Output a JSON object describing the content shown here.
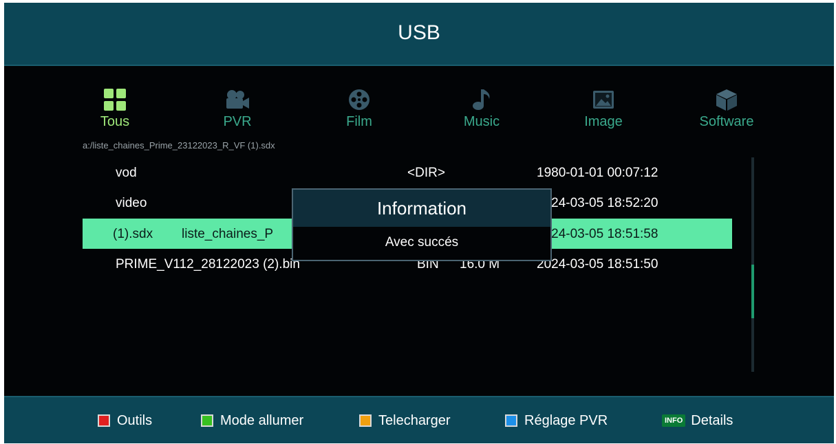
{
  "header": {
    "title": "USB"
  },
  "categories": [
    {
      "label": "Tous",
      "icon": "grid-icon",
      "active": true
    },
    {
      "label": "PVR",
      "icon": "camera-icon",
      "active": false
    },
    {
      "label": "Film",
      "icon": "film-reel-icon",
      "active": false
    },
    {
      "label": "Music",
      "icon": "music-note-icon",
      "active": false
    },
    {
      "label": "Image",
      "icon": "picture-icon",
      "active": false
    },
    {
      "label": "Software",
      "icon": "package-icon",
      "active": false
    }
  ],
  "path": "a:/liste_chaines_Prime_23122023_R_VF (1).sdx",
  "files": [
    {
      "name": "vod",
      "type": "<DIR>",
      "size": "",
      "date": "1980-01-01 00:07:12"
    },
    {
      "name": "video",
      "type": "",
      "size": "",
      "date": "2024-03-05 18:52:20"
    },
    {
      "name": "(1).sdx",
      "name2": "liste_chaines_P",
      "type": "",
      "size": "",
      "date": "2024-03-05 18:51:58",
      "selected": true
    },
    {
      "name": "PRIME_V112_28122023 (2).bin",
      "type": "BIN",
      "size": "16.0 M",
      "date": "2024-03-05 18:51:50"
    }
  ],
  "dialog": {
    "title": "Information",
    "message": "Avec succés"
  },
  "footer": [
    {
      "color": "#e02020",
      "label": "Outils"
    },
    {
      "color": "#38c020",
      "label": "Mode allumer"
    },
    {
      "color": "#f0a010",
      "label": "Telecharger"
    },
    {
      "color": "#1e90e8",
      "label": "Réglage PVR"
    },
    {
      "badge": "INFO",
      "label": "Details"
    }
  ],
  "colors": {
    "header_bg": "#0c4656",
    "selected_row": "#5ee8a6",
    "active_category": "#9fe87a",
    "category": "#3aa98c"
  }
}
